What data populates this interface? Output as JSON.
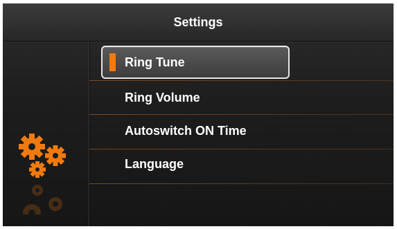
{
  "header": {
    "title": "Settings"
  },
  "menu": {
    "items": [
      {
        "label": "Ring Tune",
        "selected": true
      },
      {
        "label": "Ring Volume",
        "selected": false
      },
      {
        "label": "Autoswitch ON Time",
        "selected": false
      },
      {
        "label": "Language",
        "selected": false
      }
    ]
  },
  "icons": {
    "left_pane": "gears-icon"
  },
  "colors": {
    "accent": "#f07a10",
    "gear": "#f07a10",
    "text": "#ffffff"
  }
}
